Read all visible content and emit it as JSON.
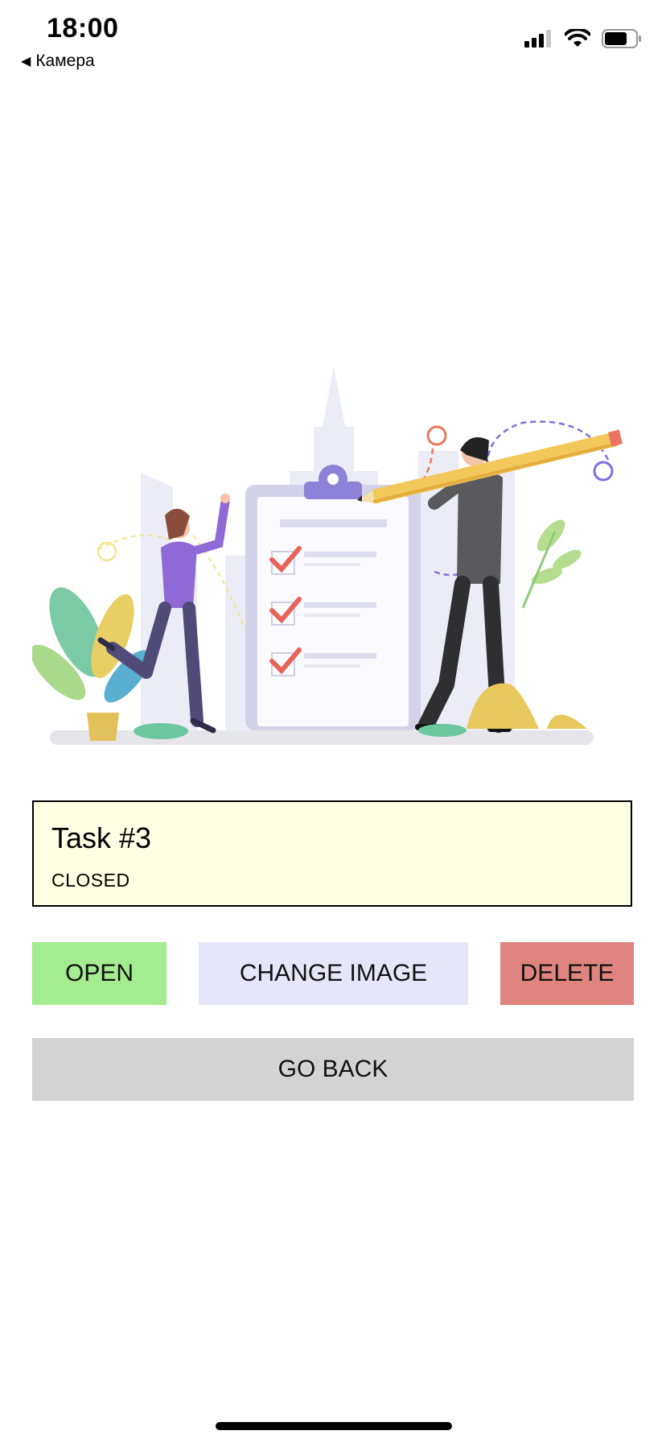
{
  "status_bar": {
    "time": "18:00",
    "back_label": "Камера",
    "icons": [
      "signal-icon",
      "wifi-icon",
      "battery-icon"
    ]
  },
  "illustration": {
    "icon": "task-checklist-illustration"
  },
  "task": {
    "title": "Task #3",
    "status": "CLOSED"
  },
  "buttons": {
    "open": "OPEN",
    "change_image": "CHANGE IMAGE",
    "delete": "DELETE",
    "go_back": "GO BACK"
  },
  "colors": {
    "card_bg": "#ffffe4",
    "open_bg": "#a3ec8f",
    "change_bg": "#e6e6f9",
    "delete_bg": "#e08480",
    "back_bg": "#d3d3d3"
  }
}
